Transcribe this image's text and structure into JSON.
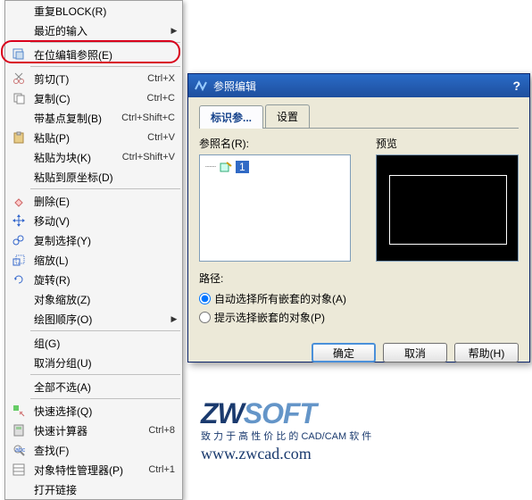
{
  "menu": {
    "items": [
      {
        "label": "重复BLOCK(R)",
        "shortcut": "",
        "arrow": false,
        "icon": ""
      },
      {
        "label": "最近的输入",
        "shortcut": "",
        "arrow": true,
        "icon": ""
      },
      {
        "sep": true
      },
      {
        "label": "在位编辑参照(E)",
        "shortcut": "",
        "arrow": false,
        "icon": "edit-ref"
      },
      {
        "sep": true
      },
      {
        "label": "剪切(T)",
        "shortcut": "Ctrl+X",
        "arrow": false,
        "icon": "cut"
      },
      {
        "label": "复制(C)",
        "shortcut": "Ctrl+C",
        "arrow": false,
        "icon": "copy"
      },
      {
        "label": "带基点复制(B)",
        "shortcut": "Ctrl+Shift+C",
        "arrow": false,
        "icon": ""
      },
      {
        "label": "粘贴(P)",
        "shortcut": "Ctrl+V",
        "arrow": false,
        "icon": "paste"
      },
      {
        "label": "粘贴为块(K)",
        "shortcut": "Ctrl+Shift+V",
        "arrow": false,
        "icon": ""
      },
      {
        "label": "粘贴到原坐标(D)",
        "shortcut": "",
        "arrow": false,
        "icon": ""
      },
      {
        "sep": true
      },
      {
        "label": "删除(E)",
        "shortcut": "",
        "arrow": false,
        "icon": "erase"
      },
      {
        "label": "移动(V)",
        "shortcut": "",
        "arrow": false,
        "icon": "move"
      },
      {
        "label": "复制选择(Y)",
        "shortcut": "",
        "arrow": false,
        "icon": "copysel"
      },
      {
        "label": "缩放(L)",
        "shortcut": "",
        "arrow": false,
        "icon": "scale"
      },
      {
        "label": "旋转(R)",
        "shortcut": "",
        "arrow": false,
        "icon": "rotate"
      },
      {
        "label": "对象缩放(Z)",
        "shortcut": "",
        "arrow": false,
        "icon": ""
      },
      {
        "label": "绘图顺序(O)",
        "shortcut": "",
        "arrow": true,
        "icon": ""
      },
      {
        "sep": true
      },
      {
        "label": "组(G)",
        "shortcut": "",
        "arrow": false,
        "icon": ""
      },
      {
        "label": "取消分组(U)",
        "shortcut": "",
        "arrow": false,
        "icon": ""
      },
      {
        "sep": true
      },
      {
        "label": "全部不选(A)",
        "shortcut": "",
        "arrow": false,
        "icon": ""
      },
      {
        "sep": true
      },
      {
        "label": "快速选择(Q)",
        "shortcut": "",
        "arrow": false,
        "icon": "qselect"
      },
      {
        "label": "快速计算器",
        "shortcut": "Ctrl+8",
        "arrow": false,
        "icon": "calc"
      },
      {
        "label": "查找(F)",
        "shortcut": "",
        "arrow": false,
        "icon": "find"
      },
      {
        "label": "对象特性管理器(P)",
        "shortcut": "Ctrl+1",
        "arrow": false,
        "icon": "props"
      },
      {
        "label": "打开链接",
        "shortcut": "",
        "arrow": false,
        "icon": ""
      }
    ]
  },
  "dialog": {
    "title": "参照编辑",
    "tabs": {
      "active": "标识参...",
      "other": "设置"
    },
    "refname_label": "参照名(R):",
    "preview_label": "预览",
    "node_value": "1",
    "path_label": "路径:",
    "radio1": "自动选择所有嵌套的对象(A)",
    "radio2": "提示选择嵌套的对象(P)",
    "buttons": {
      "ok": "确定",
      "cancel": "取消",
      "help": "帮助(H)"
    }
  },
  "logo": {
    "sub": "致 力 于 高 性 价 比 的 CAD/CAM 软 件",
    "url": "www.zwcad.com"
  }
}
